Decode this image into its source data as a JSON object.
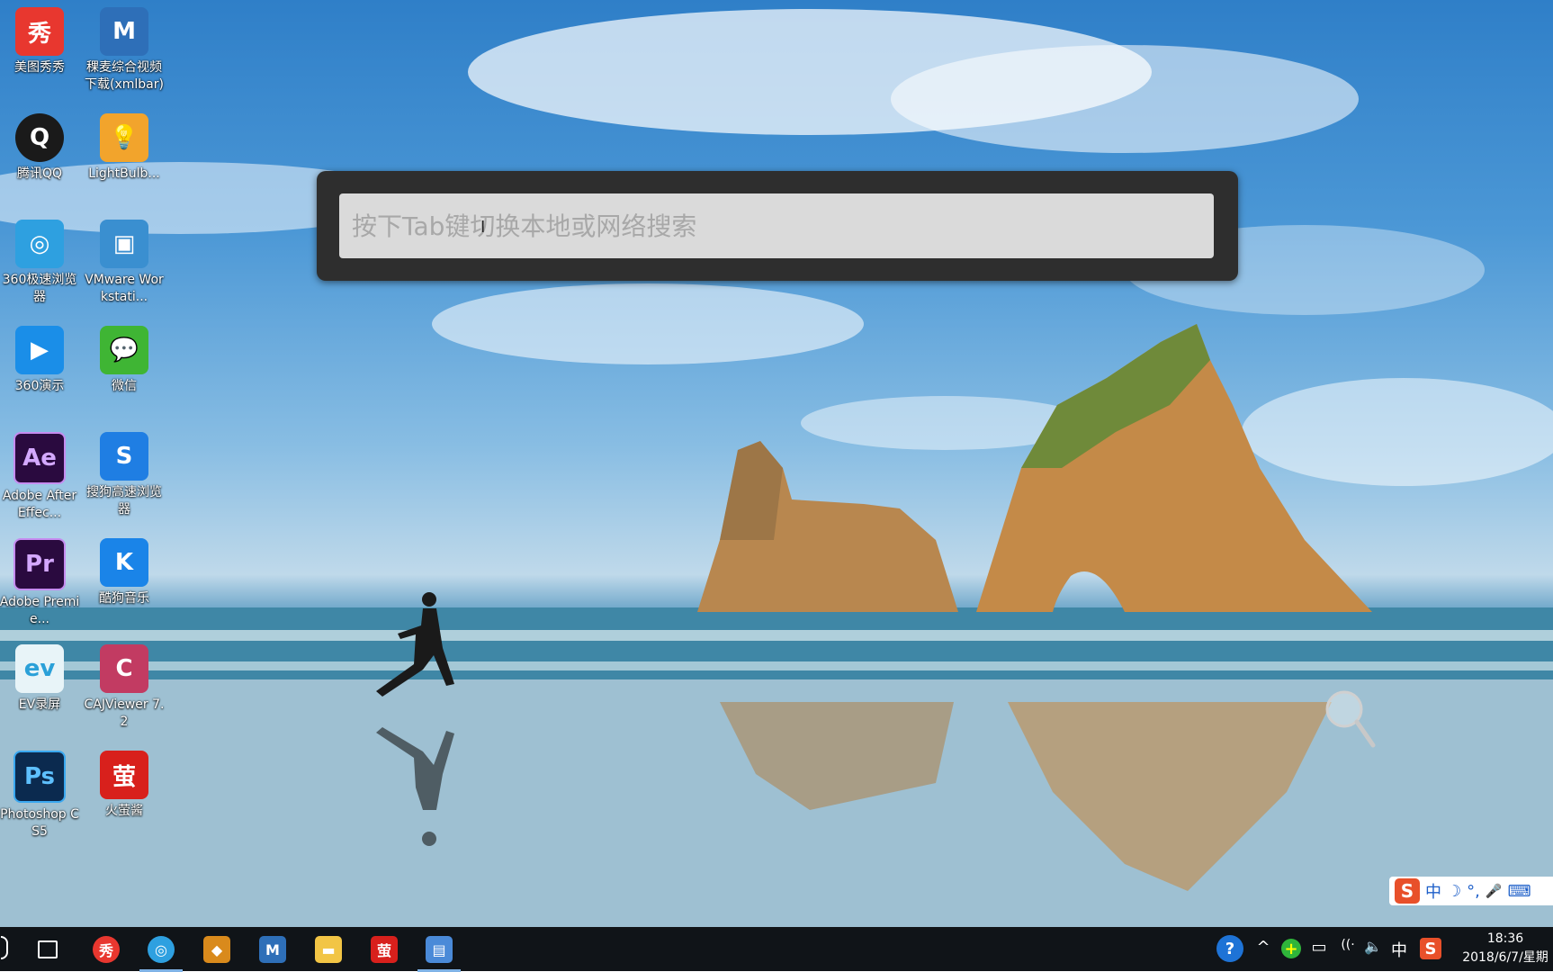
{
  "desktop": {
    "icons": [
      {
        "label": "美图秀秀",
        "glyph": "秀",
        "color": "#e8372f",
        "name": "meitu-xiuxiu"
      },
      {
        "label": "稞麦综合视频下载(xmlbar)",
        "glyph": "M",
        "color": "#2e6fb8",
        "name": "xmlbar"
      },
      {
        "label": "腾讯QQ",
        "glyph": "Q",
        "color": "#1a1a1a",
        "name": "tencent-qq"
      },
      {
        "label": "LightBulb...",
        "glyph": "💡",
        "color": "#f2a42c",
        "name": "lightbulb"
      },
      {
        "label": "360极速浏览器",
        "glyph": "◎",
        "color": "#2ea0e0",
        "name": "360-browser"
      },
      {
        "label": "VMware Workstati...",
        "glyph": "▣",
        "color": "#3a8fd0",
        "name": "vmware"
      },
      {
        "label": "360演示",
        "glyph": "▶",
        "color": "#1a8ee8",
        "name": "360-slides"
      },
      {
        "label": "微信",
        "glyph": "💬",
        "color": "#3fb534",
        "name": "wechat"
      },
      {
        "label": "Adobe After Effec...",
        "glyph": "Ae",
        "color": "#2a0a3f",
        "name": "after-effects"
      },
      {
        "label": "搜狗高速浏览器",
        "glyph": "S",
        "color": "#1f7ee3",
        "name": "sogou-browser"
      },
      {
        "label": "Adobe Premie...",
        "glyph": "Pr",
        "color": "#2a0a3f",
        "name": "premiere"
      },
      {
        "label": "酷狗音乐",
        "glyph": "K",
        "color": "#1a84e8",
        "name": "kugou"
      },
      {
        "label": "EV录屏",
        "glyph": "ev",
        "color": "#e8f4f8",
        "name": "ev-recorder"
      },
      {
        "label": "CAJViewer 7.2",
        "glyph": "C",
        "color": "#c23b62",
        "name": "cajviewer"
      },
      {
        "label": "Photoshop CS5",
        "glyph": "Ps",
        "color": "#0b2a4f",
        "name": "photoshop"
      },
      {
        "label": "火萤酱",
        "glyph": "萤",
        "color": "#d8201c",
        "name": "huoying"
      }
    ]
  },
  "search": {
    "placeholder": "按下Tab键切换本地或网络搜索",
    "value": ""
  },
  "ime": {
    "logo": "S",
    "mode": "中",
    "moon": "☽",
    "punct": "°,",
    "mic": "🎤",
    "keyboard": "⌨"
  },
  "taskbar": {
    "apps": [
      {
        "name": "task-view",
        "glyph": "❐",
        "color": "transparent"
      },
      {
        "name": "meitu-xiuxiu",
        "glyph": "秀",
        "color": "#e8372f"
      },
      {
        "name": "360-browser",
        "glyph": "◎",
        "color": "#2ea0e0"
      },
      {
        "name": "media-player",
        "glyph": "◆",
        "color": "#d98a1c"
      },
      {
        "name": "xmlbar",
        "glyph": "M",
        "color": "#2e6fb8"
      },
      {
        "name": "file-explorer",
        "glyph": "▬",
        "color": "#f2c545"
      },
      {
        "name": "huoying",
        "glyph": "萤",
        "color": "#d8201c"
      },
      {
        "name": "remote-desktop",
        "glyph": "▤",
        "color": "#4a8ad8"
      }
    ],
    "tray": {
      "help": "?",
      "chevron": "^",
      "plus": "+",
      "battery": "▭",
      "wifi": "((·",
      "volume": "🔈",
      "ime": "中",
      "sogou": "S"
    },
    "clock": {
      "time": "18:36",
      "date": "2018/6/7/星期"
    }
  }
}
